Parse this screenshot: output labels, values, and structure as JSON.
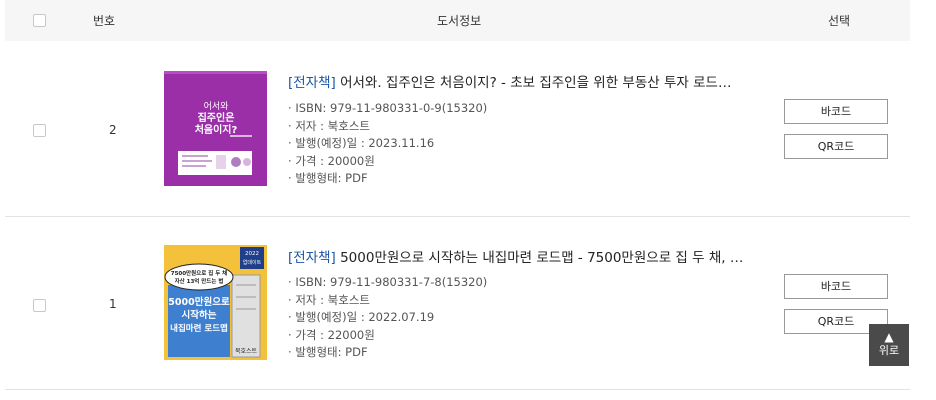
{
  "header": {
    "num_label": "번호",
    "info_label": "도서정보",
    "select_label": "선택"
  },
  "books": [
    {
      "number": "2",
      "type_tag": "[전자책]",
      "title": " 어서와. 집주인은 처음이지? - 초보 집주인을 위한 부동산 투자 로드…",
      "isbn": "ISBN: 979-11-980331-0-9(15320)",
      "author": "저자 : 북호스트",
      "pub_date": "발행(예정)일 : 2023.11.16",
      "price": "가격 : 20000원",
      "format": "발행형태: PDF",
      "barcode_label": "바코드",
      "qr_label": "QR코드",
      "cover": {
        "bg": "#9a2fa8",
        "line1": "어서와",
        "line2": "집주인은",
        "line3": "처음이지?"
      }
    },
    {
      "number": "1",
      "type_tag": "[전자책]",
      "title": " 5000만원으로 시작하는 내집마련 로드맵 - 7500만원으로 집 두 채, …",
      "isbn": "ISBN: 979-11-980331-7-8(15320)",
      "author": "저자 : 북호스트",
      "pub_date": "발행(예정)일 : 2022.07.19",
      "price": "가격 : 22000원",
      "format": "발행형태: PDF",
      "barcode_label": "바코드",
      "qr_label": "QR코드",
      "cover": {
        "bg": "#f3c23a",
        "badge1": "2022",
        "badge2": "업데이트",
        "bubble1": "7500만원으로 집 두 채",
        "bubble2": "자산 13억 만드는 법",
        "main1": "5000만원으로",
        "main2": "시작하는",
        "main3": "내집마련 로드맵",
        "publisher": "북호스트"
      }
    }
  ],
  "scroll_top": {
    "label": "위로"
  }
}
